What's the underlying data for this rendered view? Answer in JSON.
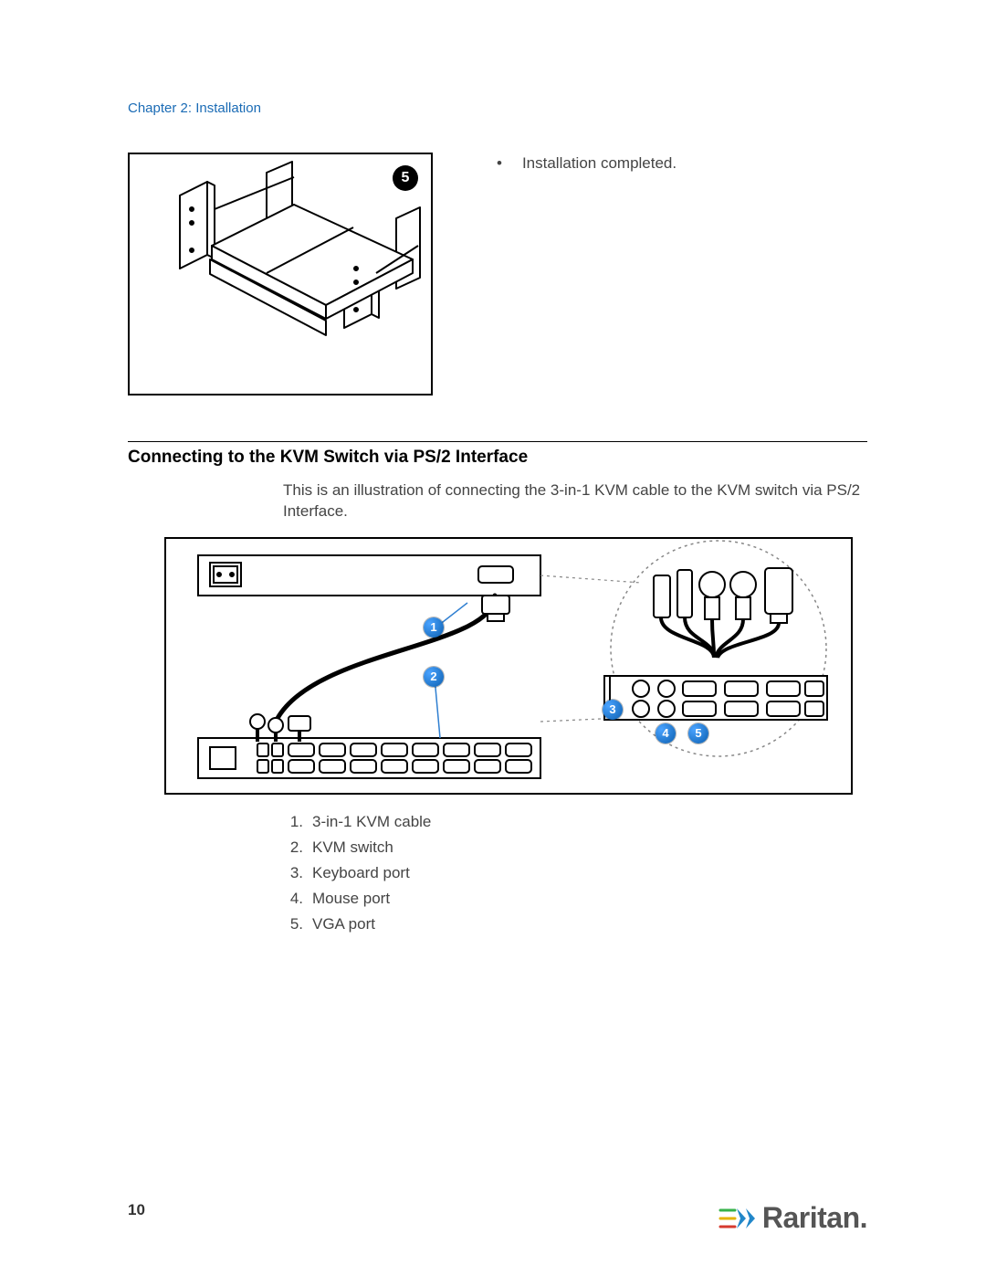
{
  "chapter_header": "Chapter 2: Installation",
  "top": {
    "step_number": "5",
    "bullet_text": "Installation completed."
  },
  "section": {
    "heading": "Connecting to the KVM Switch via PS/2 Interface",
    "intro": "This is an illustration of connecting the 3-in-1 KVM cable to the KVM switch via PS/2 Interface."
  },
  "diagram": {
    "callouts": {
      "c1": "1",
      "c2": "2",
      "c3": "3",
      "c4": "4",
      "c5": "5"
    }
  },
  "legend": {
    "items": [
      {
        "num": "1.",
        "label": "3-in-1 KVM cable"
      },
      {
        "num": "2.",
        "label": "KVM switch"
      },
      {
        "num": "3.",
        "label": "Keyboard port"
      },
      {
        "num": "4.",
        "label": "Mouse port"
      },
      {
        "num": "5.",
        "label": "VGA port"
      }
    ]
  },
  "page_number": "10",
  "brand": "Raritan."
}
